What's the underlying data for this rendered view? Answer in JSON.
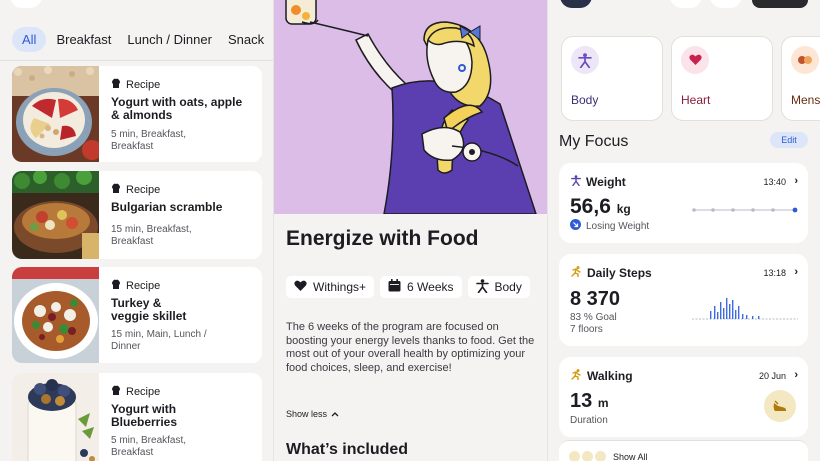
{
  "filters": [
    {
      "label": "All",
      "active": true
    },
    {
      "label": "Breakfast",
      "active": false
    },
    {
      "label": "Lunch / Dinner",
      "active": false
    },
    {
      "label": "Snack",
      "active": false
    }
  ],
  "recipes": [
    {
      "kind": "Recipe",
      "title": "Yogurt with oats, apple & almonds",
      "meta": "5 min, Breakfast, Breakfast"
    },
    {
      "kind": "Recipe",
      "title": "Bulgarian scramble",
      "meta": "15 min, Breakfast, Breakfast"
    },
    {
      "kind": "Recipe",
      "title": "Turkey & veggie skillet",
      "meta": "15 min, Main, Lunch / Dinner"
    },
    {
      "kind": "Recipe",
      "title": "Yogurt with Blueberries",
      "meta": "5 min, Breakfast, Breakfast"
    }
  ],
  "program": {
    "title": "Energize with Food",
    "tags": [
      {
        "icon": "heart-icon",
        "label": "Withings+"
      },
      {
        "icon": "calendar-icon",
        "label": "6 Weeks"
      },
      {
        "icon": "body-icon",
        "label": "Body"
      }
    ],
    "description": "The 6 weeks of the program are focused on boosting your energy levels thanks to food. Get the most out of your overall health by optimizing your food choices, sleep, and exercise!",
    "show_less": "Show less",
    "included_title": "What’s included"
  },
  "categories": [
    {
      "label": "Body",
      "color": "#6b4bc2",
      "bg": "#ece6f7",
      "icon": "body-icon"
    },
    {
      "label": "Heart",
      "color": "#b3204a",
      "bg": "#fbe3ea",
      "icon": "heart-icon"
    },
    {
      "label": "Mens",
      "color": "#8a3a14",
      "bg": "#fde6d6",
      "icon": "cycle-icon"
    }
  ],
  "focus": {
    "title": "My Focus",
    "edit": "Edit",
    "weight": {
      "label": "Weight",
      "time": "13:40",
      "value": "56,6",
      "unit": "kg",
      "trend": "Losing Weight"
    },
    "steps": {
      "label": "Daily Steps",
      "time": "13:18",
      "value": "8 370",
      "goal": "83 % Goal",
      "floors": "7 floors"
    },
    "walking": {
      "label": "Walking",
      "date": "20 Jun",
      "value": "13",
      "unit": "m",
      "sub": "Duration"
    },
    "show_all": "Show All"
  },
  "colors": {
    "accent": "#2f5bd4",
    "hero_bg": "#dcbde8",
    "purple": "#5b3fb0",
    "hair": "#f2d86a"
  }
}
